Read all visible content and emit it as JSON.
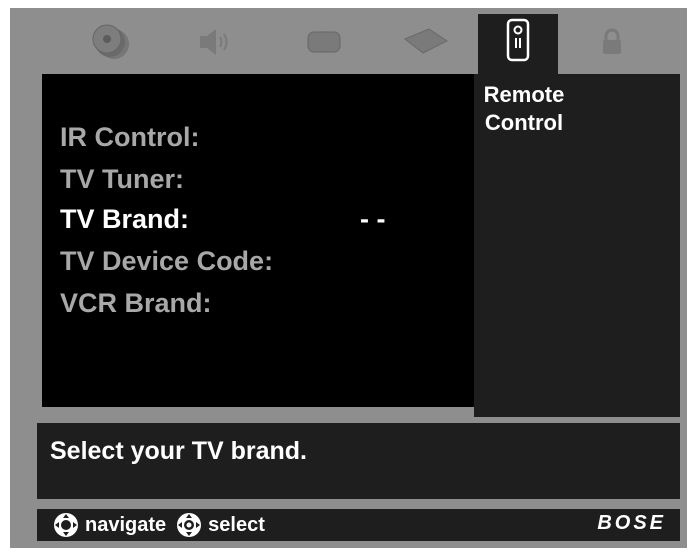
{
  "tabs": [
    {
      "icon": "disc-stack-icon"
    },
    {
      "icon": "speaker-icon"
    },
    {
      "icon": "tv-icon"
    },
    {
      "icon": "remote-pad-icon"
    },
    {
      "icon": "remote-control-icon",
      "active": true
    },
    {
      "icon": "lock-icon"
    }
  ],
  "menu": {
    "title_line1": "Remote",
    "title_line2": "Control",
    "items": [
      {
        "label": "IR Control:"
      },
      {
        "label": "TV Tuner:"
      },
      {
        "label": "TV Brand:",
        "value": "- -",
        "selected": true
      },
      {
        "label": "TV Device Code:"
      },
      {
        "label": "VCR Brand:"
      }
    ]
  },
  "message": "Select your TV brand.",
  "footer": {
    "navigate_label": "navigate",
    "select_label": "select",
    "brand": "BOSE"
  },
  "colors": {
    "frame": "#8e8e8e",
    "panel": "#000000",
    "dark_panel": "#1e1e1e",
    "item_text": "#a8a8a8",
    "selected_text": "#ffffff"
  }
}
